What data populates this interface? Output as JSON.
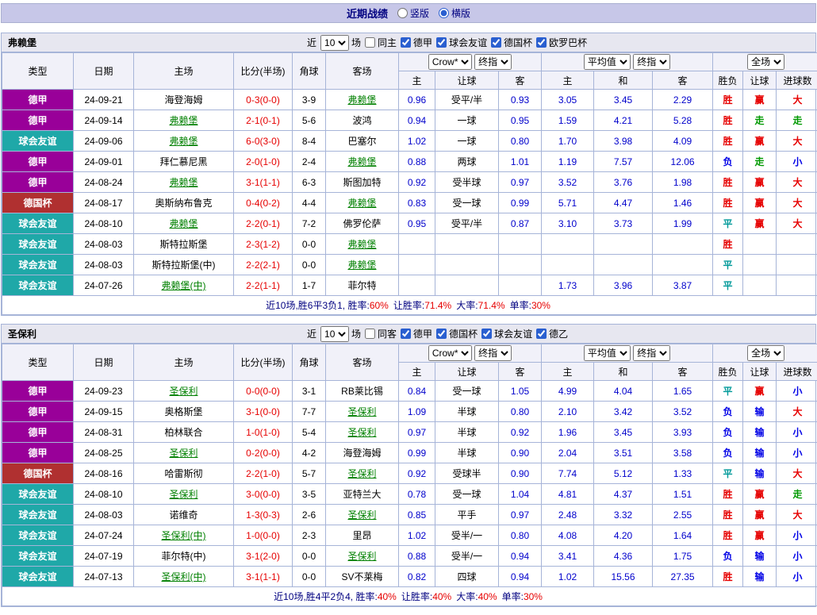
{
  "topbar": {
    "title": "近期战绩",
    "vertical": {
      "label": "竖版",
      "checked": false
    },
    "horizontal": {
      "label": "横版",
      "checked": true
    }
  },
  "header": {
    "left_cols": [
      "类型",
      "日期",
      "主场",
      "比分(半场)",
      "角球",
      "客场"
    ],
    "sub_cols": [
      "主",
      "让球",
      "客",
      "主",
      "和",
      "客",
      "胜负",
      "让球",
      "进球数"
    ]
  },
  "colors": {
    "type_badges": {
      "德甲": "#990099",
      "球会友谊": "#1fa8a8",
      "德国杯": "#b03030"
    },
    "marks": {
      "胜": "#e60000",
      "平": "#009999",
      "负": "#0000e6",
      "赢": "#e60000",
      "输": "#0000e6",
      "走": "#009900",
      "大": "#e60000",
      "小": "#0000e6"
    },
    "score": "#e60000",
    "odds": "#0000cc",
    "team_highlight": "#008000"
  },
  "sections": [
    {
      "team": "弗赖堡",
      "filter": {
        "near": "近",
        "count": "10",
        "games": "场",
        "same": {
          "label": "同主",
          "checked": false
        },
        "leagues": [
          {
            "label": "德甲",
            "checked": true
          },
          {
            "label": "球会友谊",
            "checked": true
          },
          {
            "label": "德国杯",
            "checked": true
          },
          {
            "label": "欧罗巴杯",
            "checked": true
          }
        ]
      },
      "dropdowns": {
        "asian_company": "Crow*",
        "asian_time": "终指",
        "euro_company": "平均值",
        "euro_time": "终指",
        "scope": "全场"
      },
      "rows": [
        {
          "type": "德甲",
          "date": "24-09-21",
          "home": "海登海姆",
          "home_hl": false,
          "score": "0-3(0-0)",
          "corner": "3-9",
          "away": "弗赖堡",
          "away_hl": true,
          "a_home": "0.96",
          "line": "受平/半",
          "a_away": "0.93",
          "e_home": "3.05",
          "e_draw": "3.45",
          "e_away": "2.29",
          "res": "胜",
          "h_res": "赢",
          "g_res": "大"
        },
        {
          "type": "德甲",
          "date": "24-09-14",
          "home": "弗赖堡",
          "home_hl": true,
          "score": "2-1(0-1)",
          "corner": "5-6",
          "away": "波鸿",
          "away_hl": false,
          "a_home": "0.94",
          "line": "一球",
          "a_away": "0.95",
          "e_home": "1.59",
          "e_draw": "4.21",
          "e_away": "5.28",
          "res": "胜",
          "h_res": "走",
          "g_res": "走"
        },
        {
          "type": "球会友谊",
          "date": "24-09-06",
          "home": "弗赖堡",
          "home_hl": true,
          "score": "6-0(3-0)",
          "corner": "8-4",
          "away": "巴塞尔",
          "away_hl": false,
          "a_home": "1.02",
          "line": "一球",
          "a_away": "0.80",
          "e_home": "1.70",
          "e_draw": "3.98",
          "e_away": "4.09",
          "res": "胜",
          "h_res": "赢",
          "g_res": "大"
        },
        {
          "type": "德甲",
          "date": "24-09-01",
          "home": "拜仁慕尼黑",
          "home_hl": false,
          "score": "2-0(1-0)",
          "corner": "2-4",
          "away": "弗赖堡",
          "away_hl": true,
          "a_home": "0.88",
          "line": "两球",
          "a_away": "1.01",
          "e_home": "1.19",
          "e_draw": "7.57",
          "e_away": "12.06",
          "res": "负",
          "h_res": "走",
          "g_res": "小"
        },
        {
          "type": "德甲",
          "date": "24-08-24",
          "home": "弗赖堡",
          "home_hl": true,
          "score": "3-1(1-1)",
          "corner": "6-3",
          "away": "斯图加特",
          "away_hl": false,
          "a_home": "0.92",
          "line": "受半球",
          "a_away": "0.97",
          "e_home": "3.52",
          "e_draw": "3.76",
          "e_away": "1.98",
          "res": "胜",
          "h_res": "赢",
          "g_res": "大"
        },
        {
          "type": "德国杯",
          "date": "24-08-17",
          "home": "奥斯纳布鲁克",
          "home_hl": false,
          "score": "0-4(0-2)",
          "corner": "4-4",
          "away": "弗赖堡",
          "away_hl": true,
          "a_home": "0.83",
          "line": "受一球",
          "a_away": "0.99",
          "e_home": "5.71",
          "e_draw": "4.47",
          "e_away": "1.46",
          "res": "胜",
          "h_res": "赢",
          "g_res": "大"
        },
        {
          "type": "球会友谊",
          "date": "24-08-10",
          "home": "弗赖堡",
          "home_hl": true,
          "score": "2-2(0-1)",
          "corner": "7-2",
          "away": "佛罗伦萨",
          "away_hl": false,
          "a_home": "0.95",
          "line": "受平/半",
          "a_away": "0.87",
          "e_home": "3.10",
          "e_draw": "3.73",
          "e_away": "1.99",
          "res": "平",
          "h_res": "赢",
          "g_res": "大"
        },
        {
          "type": "球会友谊",
          "date": "24-08-03",
          "home": "斯特拉斯堡",
          "home_hl": false,
          "score": "2-3(1-2)",
          "corner": "0-0",
          "away": "弗赖堡",
          "away_hl": true,
          "a_home": "",
          "line": "",
          "a_away": "",
          "e_home": "",
          "e_draw": "",
          "e_away": "",
          "res": "胜",
          "h_res": "",
          "g_res": ""
        },
        {
          "type": "球会友谊",
          "date": "24-08-03",
          "home": "斯特拉斯堡(中)",
          "home_hl": false,
          "score": "2-2(2-1)",
          "corner": "0-0",
          "away": "弗赖堡",
          "away_hl": true,
          "a_home": "",
          "line": "",
          "a_away": "",
          "e_home": "",
          "e_draw": "",
          "e_away": "",
          "res": "平",
          "h_res": "",
          "g_res": ""
        },
        {
          "type": "球会友谊",
          "date": "24-07-26",
          "home": "弗赖堡(中)",
          "home_hl": true,
          "score": "2-2(1-1)",
          "corner": "1-7",
          "away": "菲尔特",
          "away_hl": false,
          "a_home": "",
          "line": "",
          "a_away": "",
          "e_home": "1.73",
          "e_draw": "3.96",
          "e_away": "3.87",
          "res": "平",
          "h_res": "",
          "g_res": ""
        }
      ],
      "summary": {
        "prefix": "近10场,胜6平3负1,",
        "stats": [
          {
            "label": "胜率:",
            "value": "60%"
          },
          {
            "label": "让胜率:",
            "value": "71.4%"
          },
          {
            "label": "大率:",
            "value": "71.4%"
          },
          {
            "label": "单率:",
            "value": "30%"
          }
        ]
      }
    },
    {
      "team": "圣保利",
      "filter": {
        "near": "近",
        "count": "10",
        "games": "场",
        "same": {
          "label": "同客",
          "checked": false
        },
        "leagues": [
          {
            "label": "德甲",
            "checked": true
          },
          {
            "label": "德国杯",
            "checked": true
          },
          {
            "label": "球会友谊",
            "checked": true
          },
          {
            "label": "德乙",
            "checked": true
          }
        ]
      },
      "dropdowns": {
        "asian_company": "Crow*",
        "asian_time": "终指",
        "euro_company": "平均值",
        "euro_time": "终指",
        "scope": "全场"
      },
      "rows": [
        {
          "type": "德甲",
          "date": "24-09-23",
          "home": "圣保利",
          "home_hl": true,
          "score": "0-0(0-0)",
          "corner": "3-1",
          "away": "RB莱比锡",
          "away_hl": false,
          "a_home": "0.84",
          "line": "受一球",
          "a_away": "1.05",
          "e_home": "4.99",
          "e_draw": "4.04",
          "e_away": "1.65",
          "res": "平",
          "h_res": "赢",
          "g_res": "小"
        },
        {
          "type": "德甲",
          "date": "24-09-15",
          "home": "奥格斯堡",
          "home_hl": false,
          "score": "3-1(0-0)",
          "corner": "7-7",
          "away": "圣保利",
          "away_hl": true,
          "a_home": "1.09",
          "line": "半球",
          "a_away": "0.80",
          "e_home": "2.10",
          "e_draw": "3.42",
          "e_away": "3.52",
          "res": "负",
          "h_res": "输",
          "g_res": "大"
        },
        {
          "type": "德甲",
          "date": "24-08-31",
          "home": "柏林联合",
          "home_hl": false,
          "score": "1-0(1-0)",
          "corner": "5-4",
          "away": "圣保利",
          "away_hl": true,
          "a_home": "0.97",
          "line": "半球",
          "a_away": "0.92",
          "e_home": "1.96",
          "e_draw": "3.45",
          "e_away": "3.93",
          "res": "负",
          "h_res": "输",
          "g_res": "小"
        },
        {
          "type": "德甲",
          "date": "24-08-25",
          "home": "圣保利",
          "home_hl": true,
          "score": "0-2(0-0)",
          "corner": "4-2",
          "away": "海登海姆",
          "away_hl": false,
          "a_home": "0.99",
          "line": "半球",
          "a_away": "0.90",
          "e_home": "2.04",
          "e_draw": "3.51",
          "e_away": "3.58",
          "res": "负",
          "h_res": "输",
          "g_res": "小"
        },
        {
          "type": "德国杯",
          "date": "24-08-16",
          "home": "哈雷斯彻",
          "home_hl": false,
          "score": "2-2(1-0)",
          "corner": "5-7",
          "away": "圣保利",
          "away_hl": true,
          "a_home": "0.92",
          "line": "受球半",
          "a_away": "0.90",
          "e_home": "7.74",
          "e_draw": "5.12",
          "e_away": "1.33",
          "res": "平",
          "h_res": "输",
          "g_res": "大"
        },
        {
          "type": "球会友谊",
          "date": "24-08-10",
          "home": "圣保利",
          "home_hl": true,
          "score": "3-0(0-0)",
          "corner": "3-5",
          "away": "亚特兰大",
          "away_hl": false,
          "a_home": "0.78",
          "line": "受一球",
          "a_away": "1.04",
          "e_home": "4.81",
          "e_draw": "4.37",
          "e_away": "1.51",
          "res": "胜",
          "h_res": "赢",
          "g_res": "走"
        },
        {
          "type": "球会友谊",
          "date": "24-08-03",
          "home": "诺维奇",
          "home_hl": false,
          "score": "1-3(0-3)",
          "corner": "2-6",
          "away": "圣保利",
          "away_hl": true,
          "a_home": "0.85",
          "line": "平手",
          "a_away": "0.97",
          "e_home": "2.48",
          "e_draw": "3.32",
          "e_away": "2.55",
          "res": "胜",
          "h_res": "赢",
          "g_res": "大"
        },
        {
          "type": "球会友谊",
          "date": "24-07-24",
          "home": "圣保利(中)",
          "home_hl": true,
          "score": "1-0(0-0)",
          "corner": "2-3",
          "away": "里昂",
          "away_hl": false,
          "a_home": "1.02",
          "line": "受半/一",
          "a_away": "0.80",
          "e_home": "4.08",
          "e_draw": "4.20",
          "e_away": "1.64",
          "res": "胜",
          "h_res": "赢",
          "g_res": "小"
        },
        {
          "type": "球会友谊",
          "date": "24-07-19",
          "home": "菲尔特(中)",
          "home_hl": false,
          "score": "3-1(2-0)",
          "corner": "0-0",
          "away": "圣保利",
          "away_hl": true,
          "a_home": "0.88",
          "line": "受半/一",
          "a_away": "0.94",
          "e_home": "3.41",
          "e_draw": "4.36",
          "e_away": "1.75",
          "res": "负",
          "h_res": "输",
          "g_res": "小"
        },
        {
          "type": "球会友谊",
          "date": "24-07-13",
          "home": "圣保利(中)",
          "home_hl": true,
          "score": "3-1(1-1)",
          "corner": "0-0",
          "away": "SV不莱梅",
          "away_hl": false,
          "a_home": "0.82",
          "line": "四球",
          "a_away": "0.94",
          "e_home": "1.02",
          "e_draw": "15.56",
          "e_away": "27.35",
          "res": "胜",
          "h_res": "输",
          "g_res": "小"
        }
      ],
      "summary": {
        "prefix": "近10场,胜4平2负4,",
        "stats": [
          {
            "label": "胜率:",
            "value": "40%"
          },
          {
            "label": "让胜率:",
            "value": "40%"
          },
          {
            "label": "大率:",
            "value": "40%"
          },
          {
            "label": "单率:",
            "value": "30%"
          }
        ]
      }
    }
  ]
}
